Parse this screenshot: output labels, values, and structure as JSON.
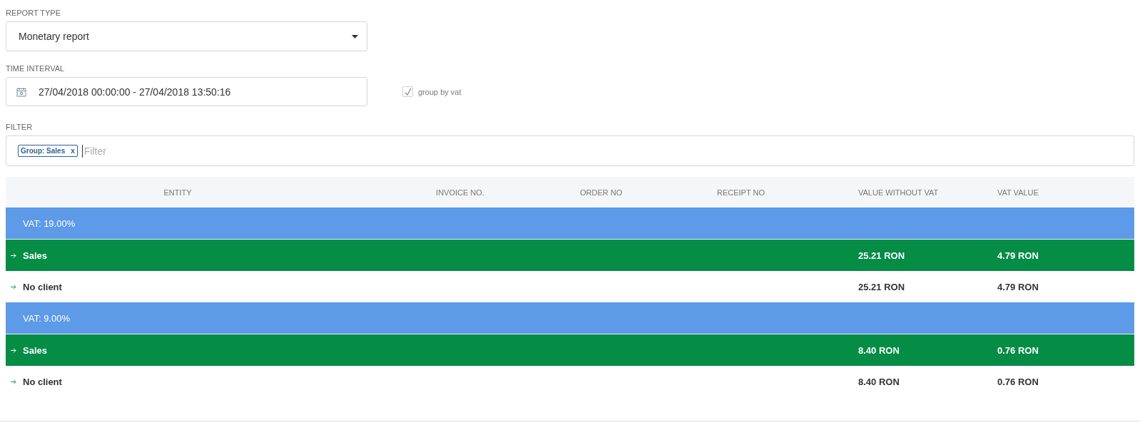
{
  "report_type": {
    "label": "REPORT TYPE",
    "value": "Monetary report"
  },
  "time_interval": {
    "label": "TIME INTERVAL",
    "value": "27/04/2018 00:00:00 - 27/04/2018 13:50:16"
  },
  "group_by_vat": {
    "label": "group by vat",
    "checked": true,
    "disabled": true
  },
  "filter": {
    "label": "FILTER",
    "tags": [
      {
        "label": "Group: Sales",
        "remove": "x"
      }
    ],
    "placeholder": "Filter"
  },
  "table": {
    "columns": [
      "ENTITY",
      "INVOICE NO.",
      "ORDER NO",
      "RECEIPT NO",
      "VALUE WITHOUT VAT",
      "VAT VALUE"
    ],
    "rows": [
      {
        "kind": "vat",
        "label": "VAT: 19.00%"
      },
      {
        "kind": "group",
        "label": "Sales",
        "value_without_vat": "25.21 RON",
        "vat_value": "4.79 RON"
      },
      {
        "kind": "client",
        "label": "No client",
        "value_without_vat": "25.21 RON",
        "vat_value": "4.79 RON"
      },
      {
        "kind": "vat",
        "label": "VAT: 9.00%"
      },
      {
        "kind": "group",
        "label": "Sales",
        "value_without_vat": "8.40 RON",
        "vat_value": "0.76 RON"
      },
      {
        "kind": "client",
        "label": "No client",
        "value_without_vat": "8.40 RON",
        "vat_value": "0.76 RON"
      }
    ]
  }
}
